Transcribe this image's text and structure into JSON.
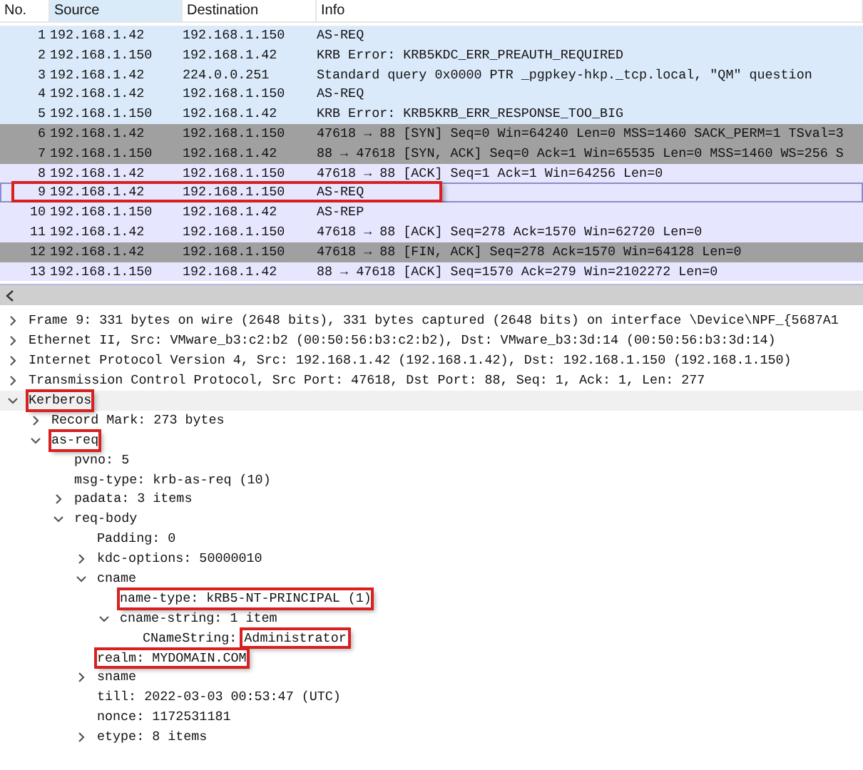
{
  "packet_list": {
    "columns": [
      {
        "label": "No.",
        "highlighted": false
      },
      {
        "label": "Source",
        "highlighted": true
      },
      {
        "label": "Destination",
        "highlighted": false
      },
      {
        "label": "Info",
        "highlighted": false
      }
    ],
    "rows": [
      {
        "no": "1",
        "source": "192.168.1.42",
        "destination": "192.168.1.150",
        "info": "AS-REQ",
        "color": "#dbeafa",
        "selected": false,
        "highlighted": false
      },
      {
        "no": "2",
        "source": "192.168.1.150",
        "destination": "192.168.1.42",
        "info": "KRB Error: KRB5KDC_ERR_PREAUTH_REQUIRED",
        "color": "#dbeafa",
        "selected": false,
        "highlighted": false
      },
      {
        "no": "3",
        "source": "192.168.1.42",
        "destination": "224.0.0.251",
        "info": "Standard query 0x0000 PTR _pgpkey-hkp._tcp.local, \"QM\" question",
        "color": "#dbeafa",
        "selected": false,
        "highlighted": false
      },
      {
        "no": "4",
        "source": "192.168.1.42",
        "destination": "192.168.1.150",
        "info": "AS-REQ",
        "color": "#dbeafa",
        "selected": false,
        "highlighted": false
      },
      {
        "no": "5",
        "source": "192.168.1.150",
        "destination": "192.168.1.42",
        "info": "KRB Error: KRB5KRB_ERR_RESPONSE_TOO_BIG",
        "color": "#dbeafa",
        "selected": false,
        "highlighted": false
      },
      {
        "no": "6",
        "source": "192.168.1.42",
        "destination": "192.168.1.150",
        "info": "47618 → 88 [SYN] Seq=0 Win=64240 Len=0 MSS=1460 SACK_PERM=1 TSval=3",
        "color": "#a0a0a0",
        "selected": false,
        "highlighted": false
      },
      {
        "no": "7",
        "source": "192.168.1.150",
        "destination": "192.168.1.42",
        "info": "88 → 47618 [SYN, ACK] Seq=0 Ack=1 Win=65535 Len=0 MSS=1460 WS=256 S",
        "color": "#a0a0a0",
        "selected": false,
        "highlighted": false
      },
      {
        "no": "8",
        "source": "192.168.1.42",
        "destination": "192.168.1.150",
        "info": "47618 → 88 [ACK] Seq=1 Ack=1 Win=64256 Len=0",
        "color": "#e7e6ff",
        "selected": false,
        "highlighted": false
      },
      {
        "no": "9",
        "source": "192.168.1.42",
        "destination": "192.168.1.150",
        "info": "AS-REQ",
        "color": "#e7e6ff",
        "selected": true,
        "highlighted": true
      },
      {
        "no": "10",
        "source": "192.168.1.150",
        "destination": "192.168.1.42",
        "info": "AS-REP",
        "color": "#e7e6ff",
        "selected": false,
        "highlighted": false
      },
      {
        "no": "11",
        "source": "192.168.1.42",
        "destination": "192.168.1.150",
        "info": "47618 → 88 [ACK] Seq=278 Ack=1570 Win=62720 Len=0",
        "color": "#e7e6ff",
        "selected": false,
        "highlighted": false
      },
      {
        "no": "12",
        "source": "192.168.1.42",
        "destination": "192.168.1.150",
        "info": "47618 → 88 [FIN, ACK] Seq=278 Ack=1570 Win=64128 Len=0",
        "color": "#a0a0a0",
        "selected": false,
        "highlighted": false
      },
      {
        "no": "13",
        "source": "192.168.1.150",
        "destination": "192.168.1.42",
        "info": "88 → 47618 [ACK] Seq=1570 Ack=279 Win=2102272 Len=0",
        "color": "#e7e6ff",
        "selected": false,
        "highlighted": false
      }
    ]
  },
  "details": [
    {
      "text": "Frame 9: 331 bytes on wire (2648 bits), 331 bytes captured (2648 bits) on interface \\Device\\NPF_{5687A1",
      "expanded": false,
      "highlighted": false
    },
    {
      "text": "Ethernet II, Src: VMware_b3:c2:b2 (00:50:56:b3:c2:b2), Dst: VMware_b3:3d:14 (00:50:56:b3:3d:14)",
      "expanded": false,
      "highlighted": false
    },
    {
      "text": "Internet Protocol Version 4, Src: 192.168.1.42 (192.168.1.42), Dst: 192.168.1.150 (192.168.1.150)",
      "expanded": false,
      "highlighted": false
    },
    {
      "text": "Transmission Control Protocol, Src Port: 47618, Dst Port: 88, Seq: 1, Ack: 1, Len: 277",
      "expanded": false,
      "highlighted": false
    },
    {
      "text": "Kerberos",
      "expanded": true,
      "highlighted": true,
      "children": [
        {
          "text": "Record Mark: 273 bytes",
          "expanded": false,
          "highlighted": false
        },
        {
          "text": "as-req",
          "expanded": true,
          "highlighted": true,
          "children": [
            {
              "text": "pvno: 5",
              "highlighted": false
            },
            {
              "text": "msg-type: krb-as-req (10)",
              "highlighted": false
            },
            {
              "text": "padata: 3 items",
              "expanded": false,
              "highlighted": false
            },
            {
              "text": "req-body",
              "expanded": true,
              "highlighted": false,
              "children": [
                {
                  "text": "Padding: 0",
                  "highlighted": false
                },
                {
                  "text": "kdc-options: 50000010",
                  "expanded": false,
                  "highlighted": false
                },
                {
                  "text": "cname",
                  "expanded": true,
                  "highlighted": false,
                  "children": [
                    {
                      "text": "name-type: kRB5-NT-PRINCIPAL (1)",
                      "highlighted": true
                    },
                    {
                      "text": "cname-string: 1 item",
                      "expanded": true,
                      "highlighted": false,
                      "children": [
                        {
                          "text": "CNameString:",
                          "value": "Administrator",
                          "highlighted": false,
                          "value_highlighted": true
                        }
                      ]
                    }
                  ]
                },
                {
                  "text": "realm: MYDOMAIN.COM",
                  "highlighted": true
                },
                {
                  "text": "sname",
                  "expanded": false,
                  "highlighted": false
                },
                {
                  "text": "till: 2022-03-03 00:53:47 (UTC)",
                  "highlighted": false
                },
                {
                  "text": "nonce: 1172531181",
                  "highlighted": false
                },
                {
                  "text": "etype: 8 items",
                  "expanded": false,
                  "highlighted": false
                }
              ]
            }
          ]
        }
      ]
    }
  ]
}
